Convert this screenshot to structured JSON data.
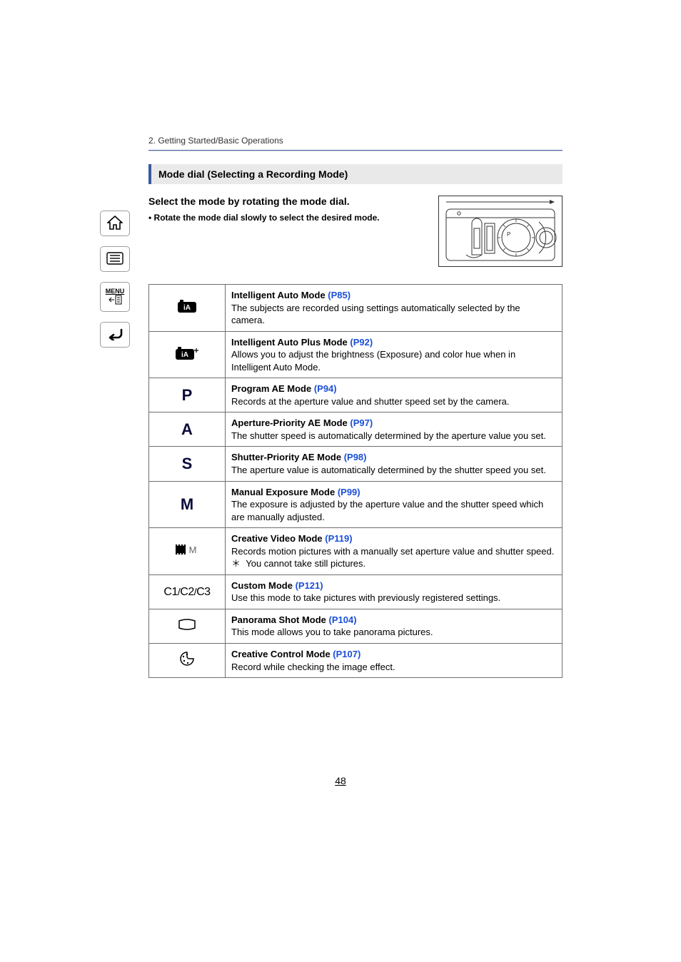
{
  "breadcrumb": "2. Getting Started/Basic Operations",
  "section_title": "Mode dial (Selecting a Recording Mode)",
  "intro": {
    "lead": "Select the mode by rotating the mode dial.",
    "bullet": "• Rotate the mode dial slowly to select the desired mode."
  },
  "sidebar": {
    "home": "home-icon",
    "list": "list-icon",
    "menu_label": "MENU",
    "back": "back-icon"
  },
  "modes": [
    {
      "icon_name": "ia-icon",
      "icon_svg": "iA",
      "title": "Intelligent Auto Mode ",
      "page": "(P85)",
      "desc": "The subjects are recorded using settings automatically selected by the camera."
    },
    {
      "icon_name": "ia-plus-icon",
      "icon_svg": "iA+",
      "title": "Intelligent Auto Plus Mode ",
      "page": "(P92)",
      "desc": "Allows you to adjust the brightness (Exposure) and color hue when in Intelligent Auto Mode."
    },
    {
      "icon_name": "p-icon",
      "icon_svg": "P",
      "title": "Program AE Mode ",
      "page": "(P94)",
      "desc": "Records at the aperture value and shutter speed set by the camera."
    },
    {
      "icon_name": "a-icon",
      "icon_svg": "A",
      "title": "Aperture-Priority AE Mode ",
      "page": "(P97)",
      "desc": "The shutter speed is automatically determined by the aperture value you set."
    },
    {
      "icon_name": "s-icon",
      "icon_svg": "S",
      "title": "Shutter-Priority AE Mode ",
      "page": "(P98)",
      "desc": "The aperture value is automatically determined by the shutter speed you set."
    },
    {
      "icon_name": "m-icon",
      "icon_svg": "M",
      "title": "Manual Exposure Mode ",
      "page": "(P99)",
      "desc": "The exposure is adjusted by the aperture value and the shutter speed which are manually adjusted."
    },
    {
      "icon_name": "video-m-icon",
      "icon_svg": "🎬M",
      "title": "Creative Video Mode ",
      "page": "(P119)",
      "desc": "Records motion pictures with a manually set aperture value and shutter speed.",
      "note": "You cannot take still pictures."
    },
    {
      "icon_name": "custom-icon",
      "icon_svg": "C1/C2/C3",
      "title": "Custom Mode ",
      "page": "(P121)",
      "desc": "Use this mode to take pictures with previously registered settings."
    },
    {
      "icon_name": "panorama-icon",
      "icon_svg": "⬚",
      "title": "Panorama Shot Mode ",
      "page": "(P104)",
      "desc": "This mode allows you to take panorama pictures."
    },
    {
      "icon_name": "creative-control-icon",
      "icon_svg": "🎨",
      "title": "Creative Control Mode ",
      "page": "(P107)",
      "desc": "Record while checking the image effect."
    }
  ],
  "page_number": "48"
}
